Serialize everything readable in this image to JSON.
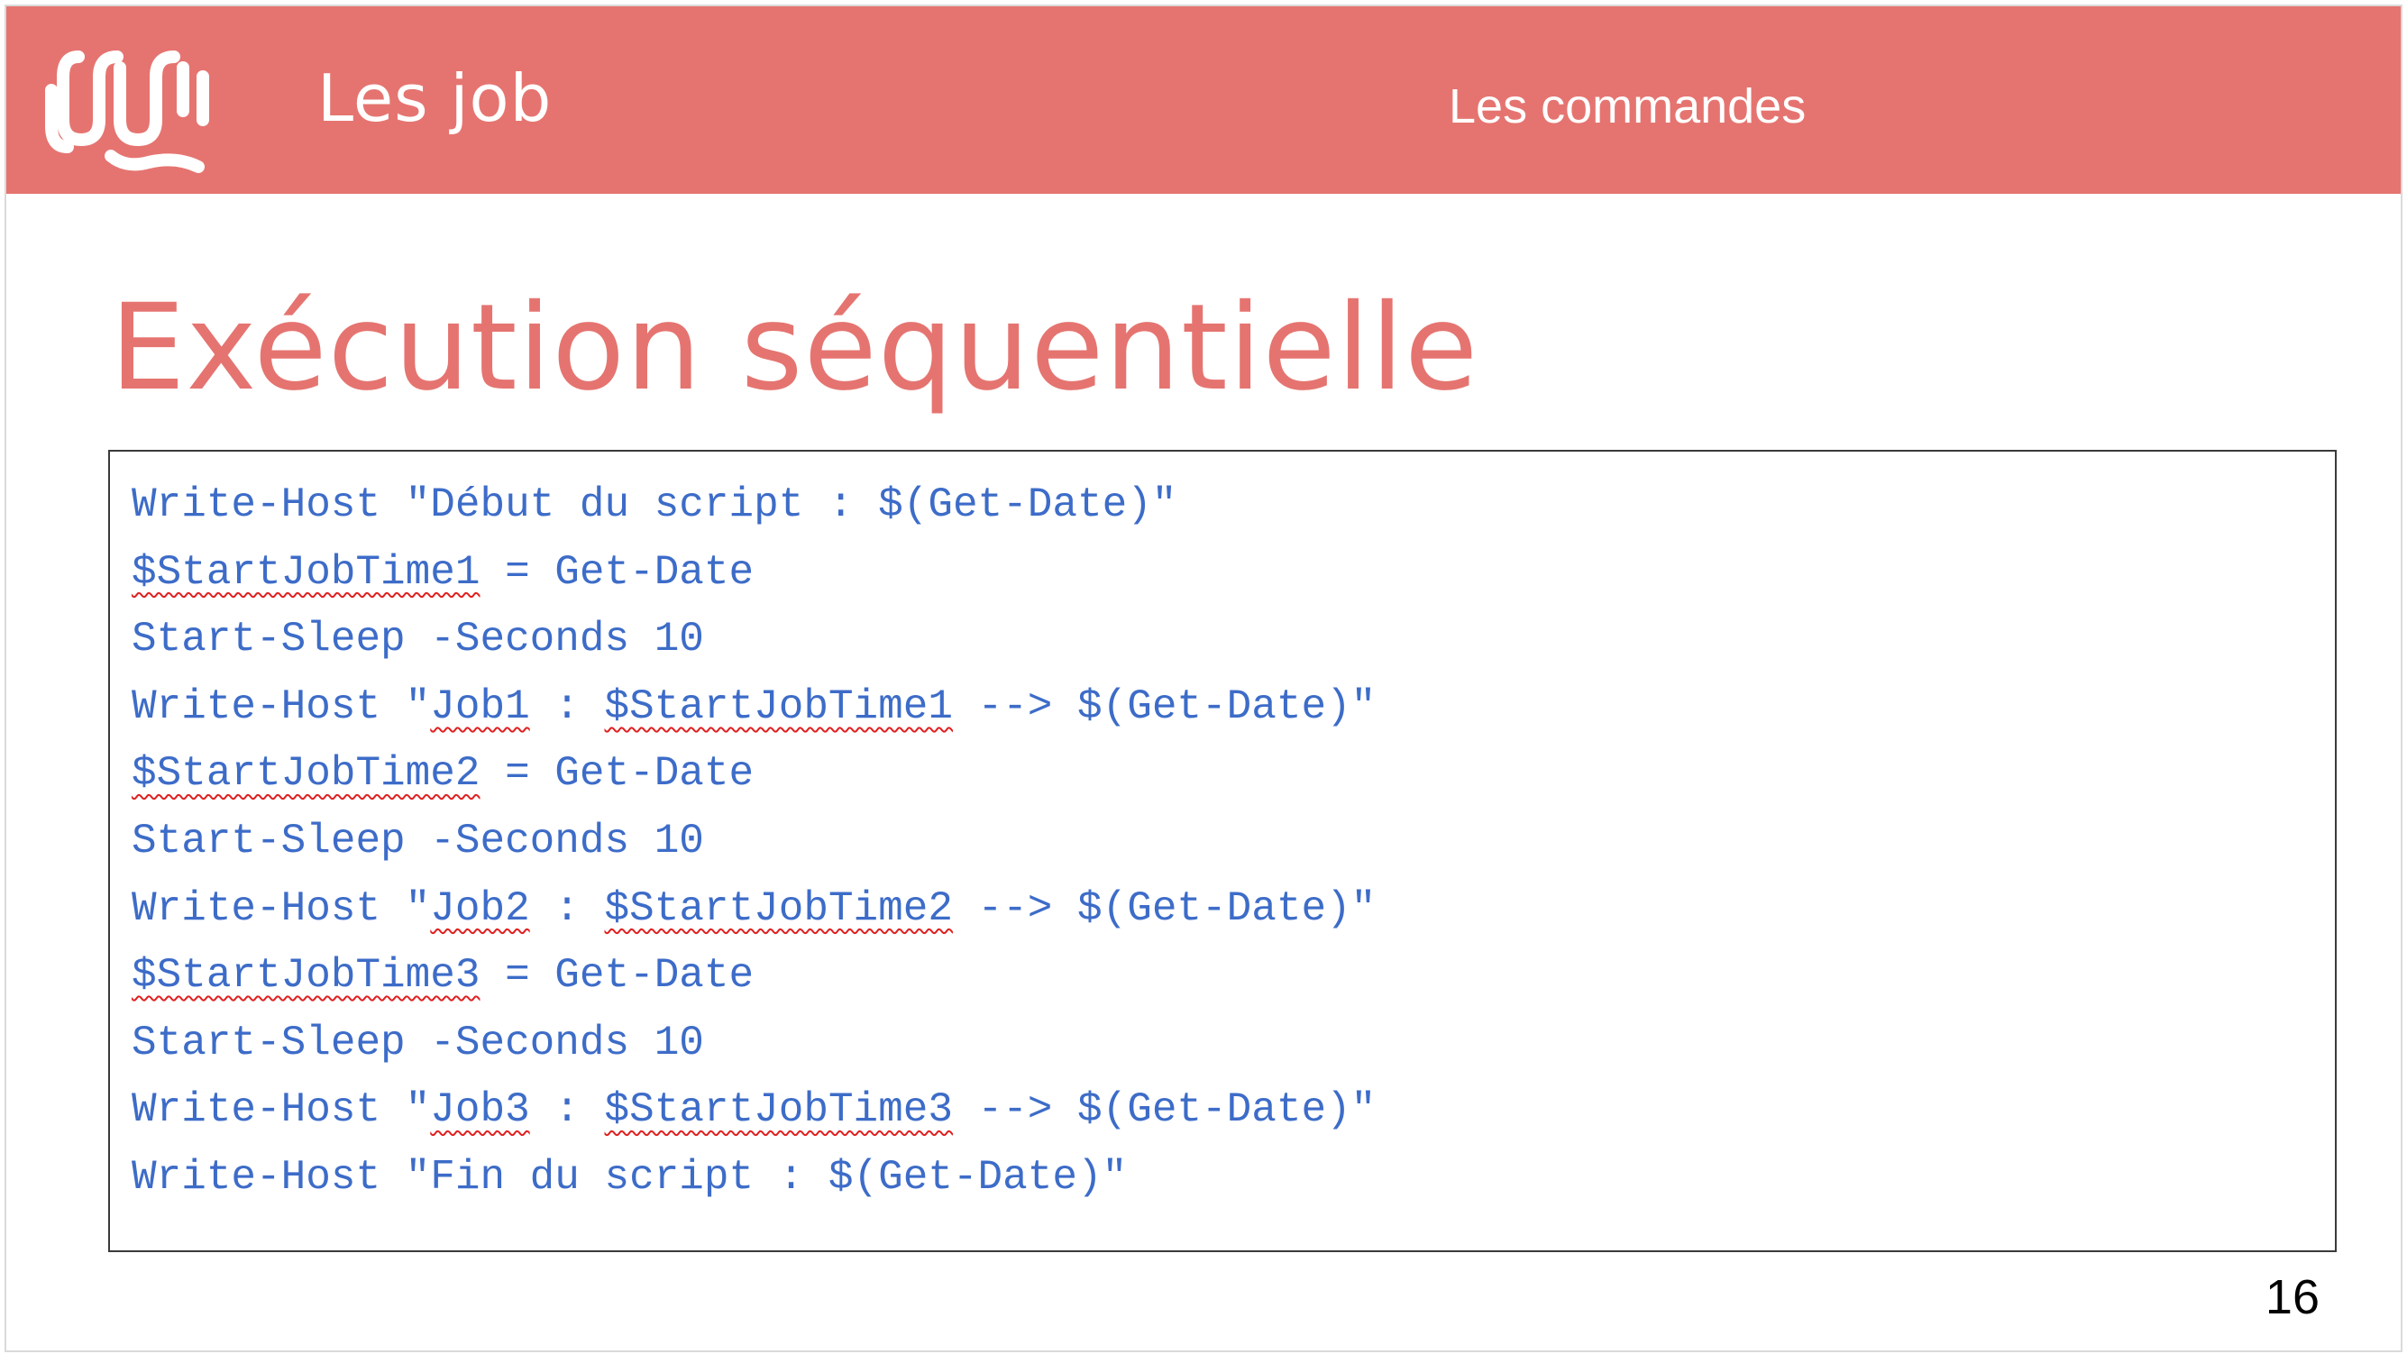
{
  "header": {
    "section_title": "Les job",
    "subtitle": "Les commandes",
    "background_color": "#e57470",
    "logo_icon": "wave-logo-icon"
  },
  "slide": {
    "title": "Exécution séquentielle",
    "page_number": "16",
    "title_color": "#e57470"
  },
  "code": {
    "text_color": "#3d6cc8",
    "lines": [
      [
        {
          "t": "Write-Host \"Début du script : $(Get-Date)\""
        }
      ],
      [
        {
          "t": "$StartJobTime1",
          "s": true
        },
        {
          "t": " = Get-Date"
        }
      ],
      [
        {
          "t": "Start-Sleep -Seconds 10"
        }
      ],
      [
        {
          "t": "Write-Host \""
        },
        {
          "t": "Job1",
          "s": true
        },
        {
          "t": " : "
        },
        {
          "t": "$StartJobTime1",
          "s": true
        },
        {
          "t": " --> $(Get-Date)\""
        }
      ],
      [
        {
          "t": "$StartJobTime2",
          "s": true
        },
        {
          "t": " = Get-Date"
        }
      ],
      [
        {
          "t": "Start-Sleep -Seconds 10"
        }
      ],
      [
        {
          "t": "Write-Host \""
        },
        {
          "t": "Job2",
          "s": true
        },
        {
          "t": " : "
        },
        {
          "t": "$StartJobTime2",
          "s": true
        },
        {
          "t": " --> $(Get-Date)\""
        }
      ],
      [
        {
          "t": "$StartJobTime3",
          "s": true
        },
        {
          "t": " = Get-Date"
        }
      ],
      [
        {
          "t": "Start-Sleep -Seconds 10"
        }
      ],
      [
        {
          "t": "Write-Host \""
        },
        {
          "t": "Job3",
          "s": true
        },
        {
          "t": " : "
        },
        {
          "t": "$StartJobTime3",
          "s": true
        },
        {
          "t": " --> $(Get-Date)\""
        }
      ],
      [
        {
          "t": "Write-Host \"Fin du script : $(Get-Date)\""
        }
      ]
    ]
  }
}
